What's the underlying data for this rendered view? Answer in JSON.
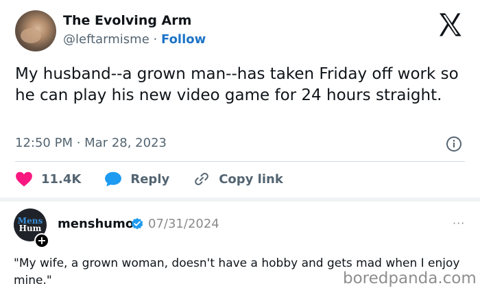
{
  "tweet": {
    "display_name": "The Evolving Arm",
    "handle": "@leftarmisme",
    "separator": "·",
    "follow_label": "Follow",
    "text": "My husband--a grown man--has taken Friday off work so he can play his new video game for 24 hours straight.",
    "timestamp": "12:50 PM · Mar 28, 2023",
    "actions": {
      "likes": "11.4K",
      "reply_label": "Reply",
      "copy_label": "Copy link"
    },
    "colors": {
      "like": "#f91880",
      "reply": "#1d9bf0",
      "follow": "#1d74c7"
    }
  },
  "post": {
    "avatar_top": "Mens",
    "avatar_bottom": "Hum",
    "username": "menshumor",
    "date": "07/31/2024",
    "more": "···",
    "text": "\"My wife, a grown woman, doesn't have a hobby and gets mad when I enjoy mine.\""
  },
  "watermark": "boredpanda.com",
  "icons": [
    "x-logo-icon",
    "info-icon",
    "heart-icon",
    "reply-bubble-icon",
    "link-icon",
    "verified-badge-icon",
    "plus-icon",
    "more-icon"
  ]
}
